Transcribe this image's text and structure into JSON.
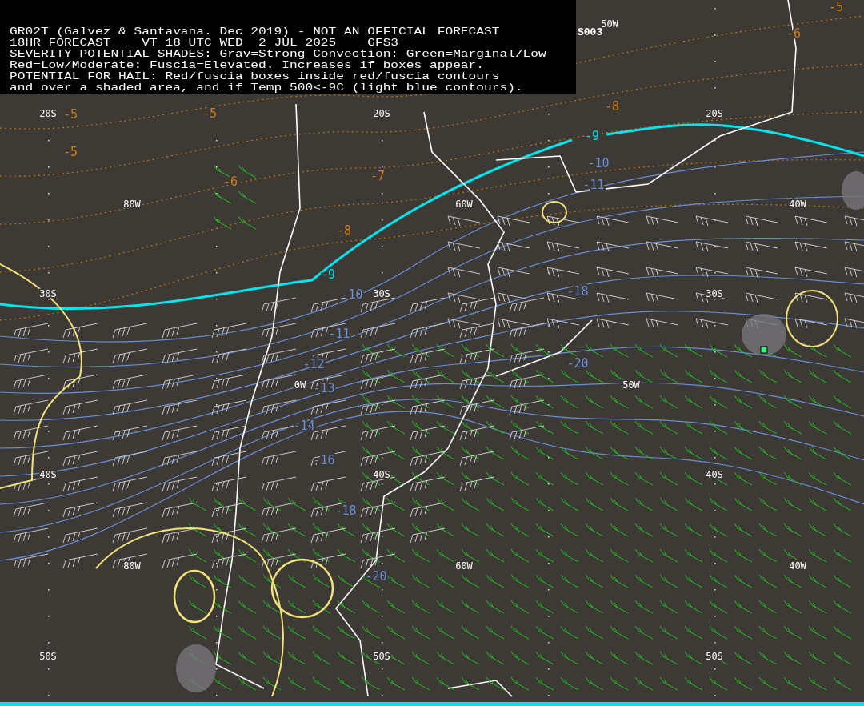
{
  "header": {
    "lines": [
      "GR02T (Galvez & Santavana. Dec 2019) - NOT AN OFFICIAL FORECAST",
      "18HR FORECAST    VT 18 UTC WED  2 JUL 2025    GFS3",
      "SEVERITY POTENTIAL SHADES: Grav=Strong Convection: Green=Marginal/Low",
      "Red=Low/Moderate: Fuscia=Elevated. Increases if boxes appear.",
      "POTENTIAL FOR HAIL: Red/fuscia boxes inside red/fuscia contours",
      "and over a shaded area, and if Temp 500<-9C (light blue contours)."
    ],
    "tag": "S003"
  },
  "grid_labels": [
    "50W",
    "20S",
    "20S",
    "20S",
    "80W",
    "60W",
    "40W",
    "30S",
    "30S",
    "30S",
    "0W",
    "50W",
    "40S",
    "40S",
    "40S",
    "80W",
    "60W",
    "40W",
    "50S",
    "50S",
    "50S"
  ],
  "contour_labels": [
    {
      "text": "-5",
      "color": "#d07e10"
    },
    {
      "text": "-5",
      "color": "#d07e10"
    },
    {
      "text": "-5",
      "color": "#d07e10"
    },
    {
      "text": "-6",
      "color": "#d07e10"
    },
    {
      "text": "-7",
      "color": "#d07e10"
    },
    {
      "text": "-8",
      "color": "#d07e10"
    },
    {
      "text": "-8",
      "color": "#d07e10"
    },
    {
      "text": "-6",
      "color": "#d07e10"
    },
    {
      "text": "-5",
      "color": "#d07e10"
    },
    {
      "text": "-9",
      "color": "#00e6f0"
    },
    {
      "text": "-9",
      "color": "#00e6f0"
    },
    {
      "text": "-10",
      "color": "#6a8ed8"
    },
    {
      "text": "-10",
      "color": "#6a8ed8"
    },
    {
      "text": "-11",
      "color": "#6a8ed8"
    },
    {
      "text": "-11",
      "color": "#6a8ed8"
    },
    {
      "text": "-12",
      "color": "#6a8ed8"
    },
    {
      "text": "-13",
      "color": "#6a8ed8"
    },
    {
      "text": "-14",
      "color": "#6a8ed8"
    },
    {
      "text": "-16",
      "color": "#6a8ed8"
    },
    {
      "text": "-18",
      "color": "#6a8ed8"
    },
    {
      "text": "-18",
      "color": "#6a8ed8"
    },
    {
      "text": "-20",
      "color": "#6a8ed8"
    },
    {
      "text": "-20",
      "color": "#6a8ed8"
    }
  ]
}
